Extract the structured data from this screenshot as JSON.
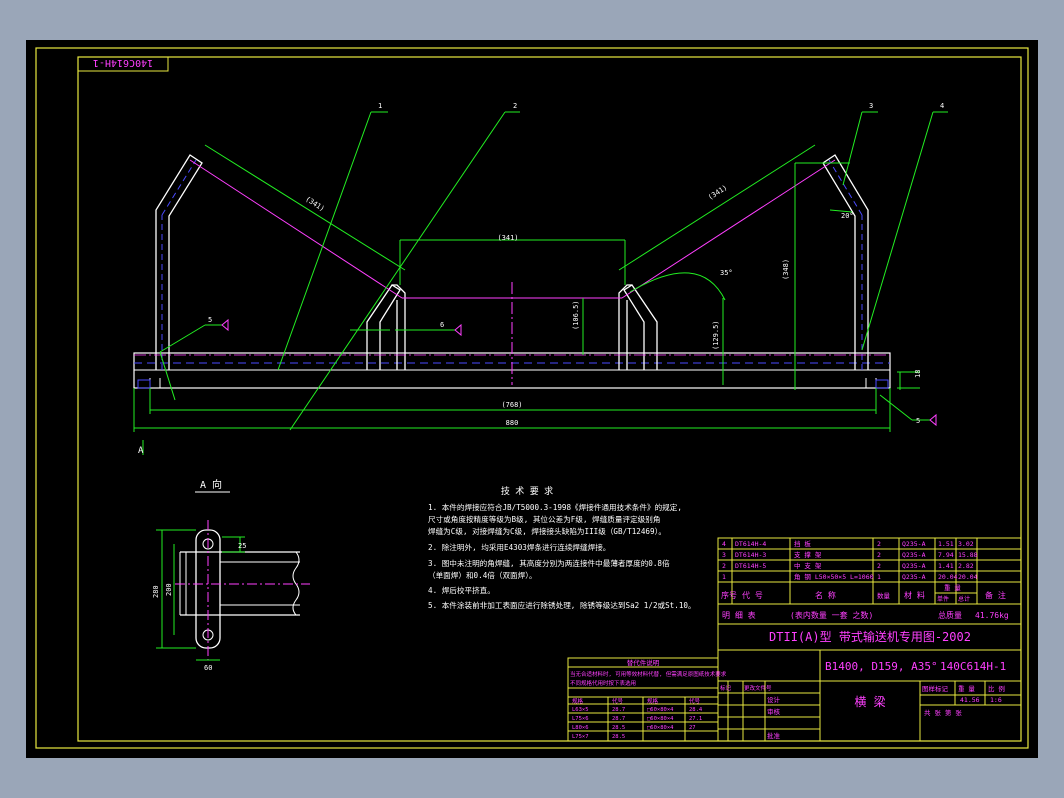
{
  "colors": {
    "background": "#9aa6b8",
    "paper": "#000000",
    "frame": "#e8e840",
    "geometry": "#ffffff",
    "leaders": "#22ee22",
    "text": "#ff40ff",
    "centerline": "#ff40ff",
    "hidden": "#4a4aff"
  },
  "drawing": {
    "code_box": "140C614H-1",
    "leaders": [
      "1",
      "2",
      "3",
      "4"
    ],
    "dims": {
      "overall_span": "880",
      "inner_span": "(768)",
      "center_roll": "(341)",
      "side_roll_left": "(341)",
      "side_roll_right": "(341)",
      "height_right": "(348)",
      "height_mid": "(106.5)",
      "bracket_h": "(129.5)",
      "angle_main": "35°",
      "angle_small": "20°",
      "thickness": "18"
    },
    "weld_marks": [
      "5",
      "6",
      "5",
      "6"
    ],
    "section_label": "A",
    "view_a": {
      "title": "A 向",
      "dim_h1": "280",
      "dim_h2": "200",
      "dim_w": "60",
      "dim_t": "25"
    }
  },
  "tech_notes": {
    "title": "技 术 要 求",
    "lines": [
      "1. 本件的焊接应符合JB/T5000.3-1998《焊接件通用技术条件》的规定,",
      "   尺寸或角度按精度等级为B级, 其位公差为F级, 焊缝质量评定级别角",
      "   焊缝为C级, 对接焊缝为C级, 焊接接头缺陷为III级（GB/T12469）。",
      "2. 除注明外, 均采用E4303焊条进行连续焊缝焊接。",
      "3. 图中未注明的角焊缝, 其高度分别为两连接件中最薄者厚度的0.8倍",
      "   （单面焊）和0.4倍（双面焊）。",
      "4. 焊后校平挤直。",
      "5. 本件涂装前非加工表面应进行除锈处理, 除锈等级达到Sa2 1/2或St.10。"
    ]
  },
  "parts_list": {
    "rows": [
      {
        "no": "4",
        "code": "DT614H-4",
        "name": "挡 板",
        "qty": "2",
        "mat": "Q235-A",
        "unit": "1.51",
        "total": "3.02"
      },
      {
        "no": "3",
        "code": "DT614H-3",
        "name": "支 撑 架",
        "qty": "2",
        "mat": "Q235-A",
        "unit": "7.94",
        "total": "15.88"
      },
      {
        "no": "2",
        "code": "DT614H-5",
        "name": "中 支 架",
        "qty": "2",
        "mat": "Q235-A",
        "unit": "1.41",
        "total": "2.82"
      },
      {
        "no": "1",
        "code": "",
        "name": "角 钢 L50×50×5 L=1060",
        "qty": "1",
        "mat": "Q235-A",
        "unit": "20.04",
        "total": "20.04"
      }
    ],
    "header": [
      "序号",
      "代 号",
      "名 称",
      "数量",
      "材 料",
      "单件",
      "总计",
      "备 注"
    ],
    "weight_label": "重 量",
    "footer_left": "明 细 表",
    "footer_mid": "(表内数量 一套 之数)",
    "footer_weight_label": "总质量",
    "total_weight": "41.76kg"
  },
  "title_block": {
    "main_title": "DTII(A)型  带式输送机专用图-2002",
    "spec": "B1400, D159, A35°",
    "drawing_no": "140C614H-1",
    "part_name": "横 梁",
    "label_stage": "图样标记",
    "label_weight": "重 量",
    "label_scale": "比 例",
    "weight_value": "41.56",
    "scale_value": "1:6",
    "sheet_info": "共   张   第   张",
    "left_labels": [
      "标记",
      "处数",
      "分区",
      "更改文件号",
      "签名",
      "年月日"
    ],
    "role_labels": [
      "设计",
      "审核",
      "工艺",
      "标准化",
      "批准"
    ]
  },
  "substitute_table": {
    "title": "替代件说明",
    "notes": [
      "当无合适材料时, 可用等效材料代替, 但需满足原图纸技术要求",
      "不同规格代用时按下表选用"
    ],
    "header": [
      "规格",
      "代号",
      "规格",
      "代号"
    ],
    "rows": [
      [
        "L63×5",
        "28.7",
        "□60×80×4",
        "28.4"
      ],
      [
        "L75×6",
        "28.7",
        "□60×80×4",
        "27.1"
      ],
      [
        "L80×6",
        "28.5",
        "□60×80×4",
        "27"
      ],
      [
        "L75×7",
        "28.5",
        "",
        ""
      ]
    ]
  }
}
